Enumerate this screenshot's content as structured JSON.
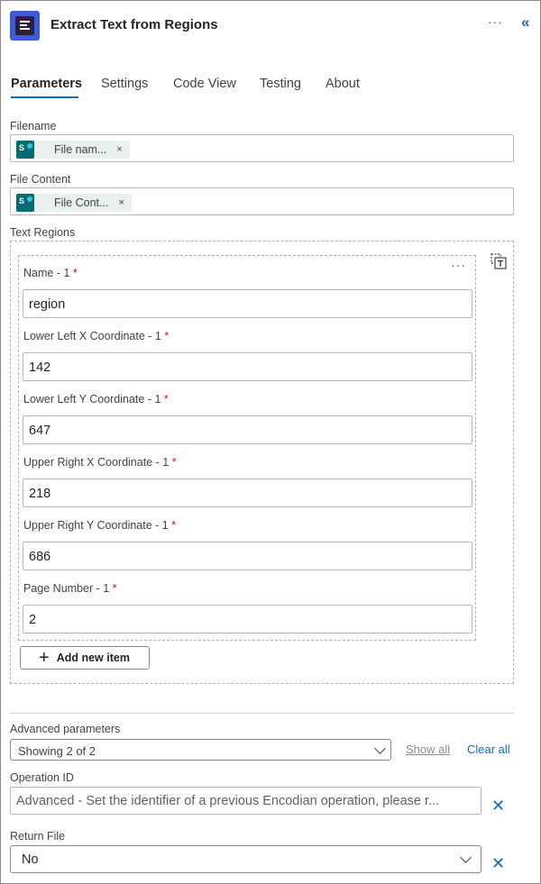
{
  "header": {
    "title": "Extract Text from Regions",
    "more_glyph": "···",
    "collapse_glyph": "«",
    "app_icon": "encodian-icon",
    "more_icon": "more-horizontal-icon",
    "collapse_icon": "double-chevron-left-icon"
  },
  "tabs": [
    {
      "label": "Parameters",
      "active": true
    },
    {
      "label": "Settings",
      "active": false
    },
    {
      "label": "Code View",
      "active": false
    },
    {
      "label": "Testing",
      "active": false
    },
    {
      "label": "About",
      "active": false
    }
  ],
  "filename": {
    "label": "Filename",
    "chip": {
      "icon": "sharepoint-icon",
      "icon_letter": "S",
      "text": "File nam...",
      "remove": "×"
    }
  },
  "file_content": {
    "label": "File Content",
    "chip": {
      "icon": "sharepoint-icon",
      "icon_letter": "S",
      "text": "File Cont...",
      "remove": "×"
    }
  },
  "text_regions": {
    "label": "Text Regions",
    "item_more": "···",
    "fields": [
      {
        "label": "Name - 1",
        "required": "*",
        "value": "region"
      },
      {
        "label": "Lower Left X Coordinate - 1",
        "required": "*",
        "value": "142"
      },
      {
        "label": "Lower Left Y Coordinate - 1",
        "required": "*",
        "value": "647"
      },
      {
        "label": "Upper Right X Coordinate - 1",
        "required": "*",
        "value": "218"
      },
      {
        "label": "Upper Right Y Coordinate - 1",
        "required": "*",
        "value": "686"
      },
      {
        "label": "Page Number - 1",
        "required": "*",
        "value": "2"
      }
    ],
    "add_item_label": "Add new item",
    "add_glyph": "+"
  },
  "advanced": {
    "label": "Advanced parameters",
    "selected": "Showing 2 of 2",
    "show_all": "Show all",
    "clear_all": "Clear all"
  },
  "operation_id": {
    "label": "Operation ID",
    "value": "Advanced - Set the identifier of a previous Encodian operation, please r...",
    "remove": "✕"
  },
  "return_file": {
    "label": "Return File",
    "value": "No",
    "remove": "✕"
  },
  "colors": {
    "accent": "#0f6cbd",
    "required": "#c50f1f",
    "chip_bg": "#e8f1f0",
    "sharepoint": "#036c70"
  }
}
